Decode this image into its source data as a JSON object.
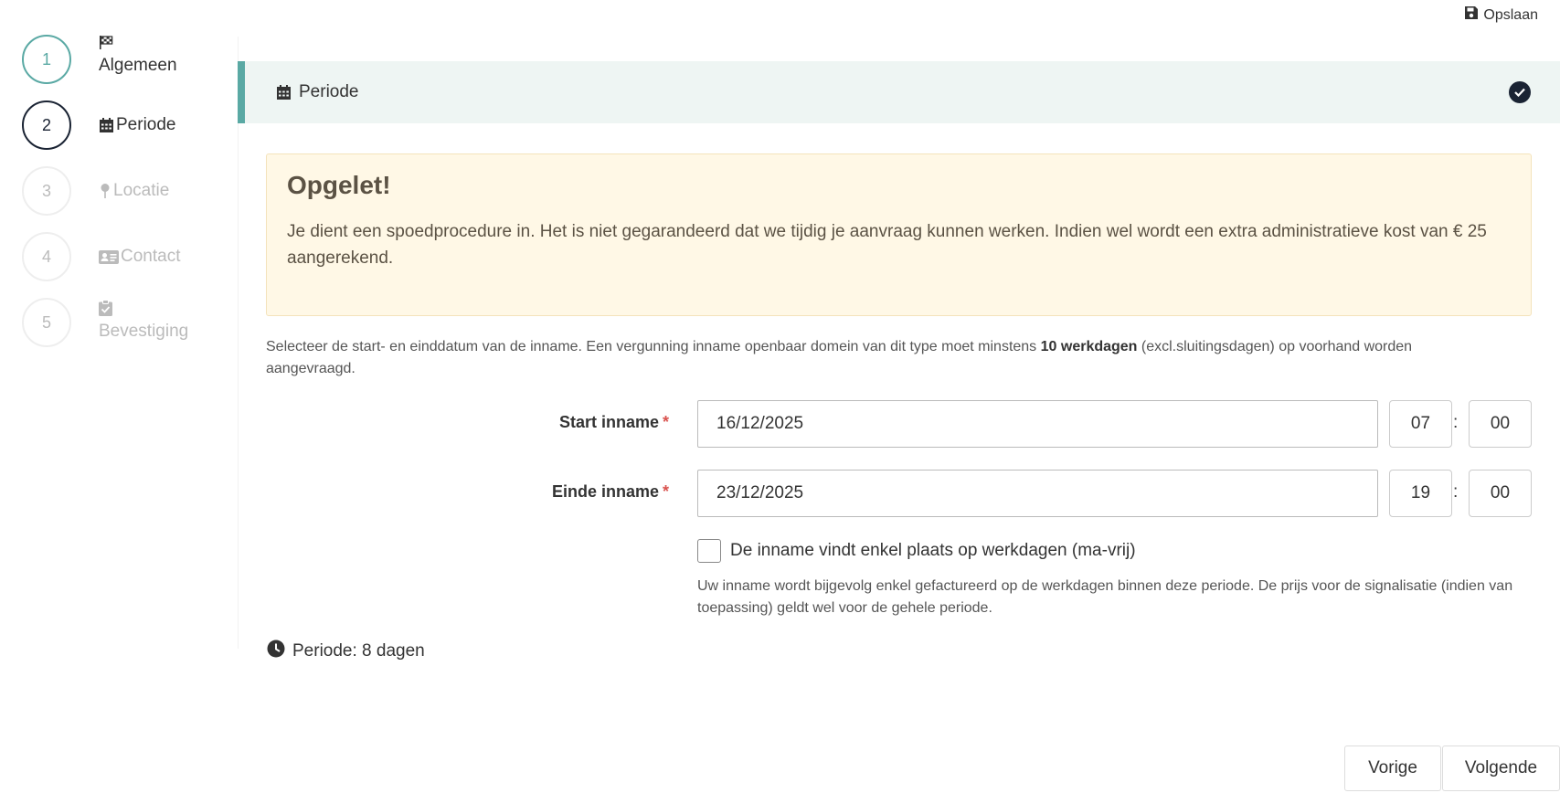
{
  "toolbar": {
    "save_label": "Opslaan",
    "save_icon": "floppy-disk-icon"
  },
  "steps": [
    {
      "number": "1",
      "label": "Algemeen",
      "icon": "flag-checkered-icon",
      "state": "completed"
    },
    {
      "number": "2",
      "label": "Periode",
      "icon": "calendar-icon",
      "state": "active"
    },
    {
      "number": "3",
      "label": "Locatie",
      "icon": "map-pin-icon",
      "state": "pending"
    },
    {
      "number": "4",
      "label": "Contact",
      "icon": "id-card-icon",
      "state": "pending"
    },
    {
      "number": "5",
      "label": "Bevestiging",
      "icon": "clipboard-check-icon",
      "state": "pending"
    }
  ],
  "section": {
    "title": "Periode",
    "icon": "calendar-icon",
    "status_icon": "check-circle-icon"
  },
  "warning": {
    "title": "Opgelet!",
    "text": "Je dient een spoedprocedure in. Het is niet gegarandeerd dat we tijdig je aanvraag kunnen werken. Indien wel wordt een extra administratieve kost van € 25 aangerekend."
  },
  "intro": {
    "before": "Selecteer de start- en einddatum van de inname. Een vergunning inname openbaar domein van dit type moet minstens ",
    "bold": "10 werkdagen",
    "after": " (excl.sluitingsdagen) op voorhand worden aangevraagd."
  },
  "form": {
    "start": {
      "label": "Start inname",
      "required_mark": "*",
      "date": "16/12/2025",
      "hour": "07",
      "minute": "00"
    },
    "end": {
      "label": "Einde inname",
      "required_mark": "*",
      "date": "23/12/2025",
      "hour": "19",
      "minute": "00"
    },
    "time_separator": ":",
    "workdays_checkbox": {
      "label": "De inname vindt enkel plaats op werkdagen (ma-vrij)",
      "checked": false
    },
    "workdays_help": "Uw inname wordt bijgevolg enkel gefactureerd op de werkdagen binnen deze periode. De prijs voor de signalisatie (indien van toepassing) geldt wel voor de gehele periode."
  },
  "summary": {
    "text": "Periode: 8 dagen",
    "icon": "clock-icon"
  },
  "nav": {
    "previous_label": "Vorige",
    "next_label": "Volgende"
  },
  "colors": {
    "accent": "#5aa9a4",
    "active": "#1a2333",
    "warning_bg": "#fff8e6",
    "required": "#d9534f"
  }
}
